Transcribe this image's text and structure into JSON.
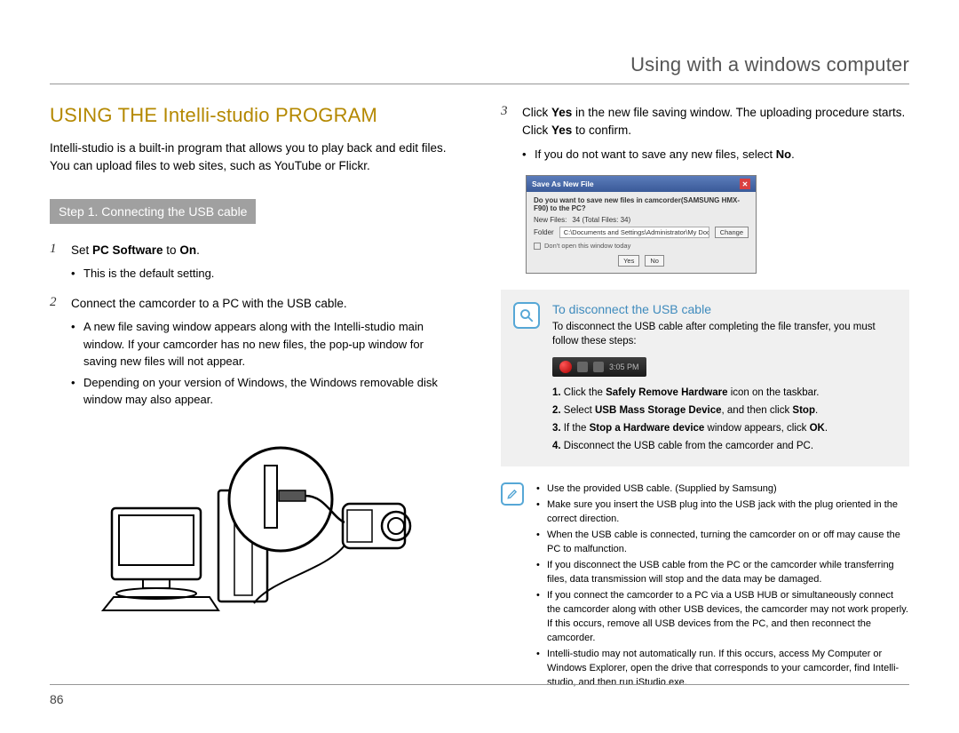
{
  "header": {
    "title": "Using with a windows computer"
  },
  "section": {
    "title": "USING THE Intelli-studio PROGRAM"
  },
  "intro": "Intelli-studio is a built-in program that allows you to play back and edit files. You can upload files to web sites, such as YouTube or Flickr.",
  "step1": {
    "bar": "Step 1. Connecting the USB cable",
    "items": [
      {
        "num": "1",
        "text_pre": "Set ",
        "bold1": "PC Software",
        "text_mid": " to ",
        "bold2": "On",
        "text_post": ".",
        "bullets": [
          "This is the default setting."
        ]
      },
      {
        "num": "2",
        "text": "Connect the camcorder to a PC with the USB cable.",
        "bullets": [
          "A new file saving window appears along with the Intelli-studio main window. If your camcorder has no new files, the pop-up window for saving new files will not appear.",
          "Depending on your version of Windows, the Windows removable disk window may also appear."
        ]
      }
    ]
  },
  "step3": {
    "num": "3",
    "l1a": "Click ",
    "l1b": "Yes",
    "l1c": " in the new file saving window. The uploading procedure starts. Click ",
    "l1d": "Yes",
    "l1e": " to confirm.",
    "bullet_a": "If you do not want to save any new files, select ",
    "bullet_b": "No",
    "bullet_c": "."
  },
  "saveDialog": {
    "title": "Save As New File",
    "question": "Do you want to save new files in camcorder(SAMSUNG HMX-F90) to the PC?",
    "newfiles_label": "New Files:",
    "newfiles_value": "34 (Total Files: 34)",
    "folder_label": "Folder",
    "folder_path": "C:\\Documents and Settings\\Administrator\\My Documents\\Intelli-s",
    "change": "Change",
    "dont_open": "Don't open this window today",
    "yes": "Yes",
    "no": "No"
  },
  "disconnect": {
    "heading": "To disconnect the USB cable",
    "lead": "To disconnect the USB cable after completing the file transfer, you must follow these steps:",
    "time": "3:05 PM",
    "steps": [
      {
        "n": "1.",
        "a": "Click the ",
        "b": "Safely Remove Hardware",
        "c": " icon on the taskbar."
      },
      {
        "n": "2.",
        "a": "Select ",
        "b": "USB Mass Storage Device",
        "c": ", and then click ",
        "d": "Stop",
        "e": "."
      },
      {
        "n": "3.",
        "a": "If the ",
        "b": "Stop a Hardware device",
        "c": " window appears, click ",
        "d": "OK",
        "e": "."
      },
      {
        "n": "4.",
        "a": "Disconnect the USB cable from the camcorder and PC."
      }
    ]
  },
  "notes": [
    "Use the provided USB cable. (Supplied by Samsung)",
    "Make sure you insert the USB plug into the USB jack with the plug oriented in the correct direction.",
    "When the USB cable is connected, turning the camcorder on or off may cause the PC to malfunction.",
    "If you disconnect the USB cable from the PC or the camcorder while transferring files, data transmission will stop and the data may be damaged.",
    "If you connect the camcorder to a PC via a USB HUB or simultaneously connect the camcorder along with other USB devices, the camcorder may not work properly. If this occurs, remove all USB devices from the PC, and then reconnect the camcorder.",
    "Intelli-studio may not automatically run. If this occurs, access My Computer or Windows Explorer, open the drive that corresponds to your camcorder, find Intelli-studio, and then run iStudio.exe."
  ],
  "pageNumber": "86"
}
